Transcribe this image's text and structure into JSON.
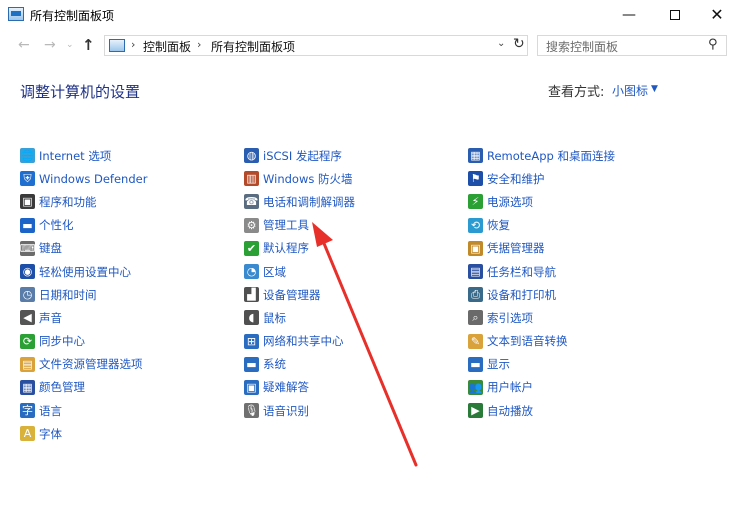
{
  "window": {
    "title": "所有控制面板项",
    "minimize_glyph": "—",
    "close_glyph": "✕"
  },
  "nav": {
    "back_glyph": "←",
    "forward_glyph": "→",
    "history_glyph": "⌄",
    "up_glyph": "↑",
    "breadcrumb": [
      "控制面板",
      "所有控制面板项"
    ],
    "breadcrumb_sep": "›",
    "dropdown_glyph": "⌄",
    "refresh_glyph": "↻"
  },
  "search": {
    "placeholder": "搜索控制面板",
    "icon_glyph": "⚲"
  },
  "header": {
    "title": "调整计算机的设置",
    "view_by_label": "查看方式:",
    "view_by_value": "小图标",
    "view_by_caret": "▼"
  },
  "columns": [
    [
      {
        "label": "Internet 选项",
        "icon": "globe-icon",
        "glyph": "🌐",
        "color": "#3aa0d8"
      },
      {
        "label": "Windows Defender",
        "icon": "shield-icon",
        "glyph": "⛨",
        "color": "#1e6fd0"
      },
      {
        "label": "程序和功能",
        "icon": "programs-icon",
        "glyph": "▣",
        "color": "#3a3a3a"
      },
      {
        "label": "个性化",
        "icon": "monitor-icon",
        "glyph": "▬",
        "color": "#1d64c8"
      },
      {
        "label": "键盘",
        "icon": "keyboard-icon",
        "glyph": "⌨",
        "color": "#6b6b6b"
      },
      {
        "label": "轻松使用设置中心",
        "icon": "ease-of-access-icon",
        "glyph": "◉",
        "color": "#1e4fa8"
      },
      {
        "label": "日期和时间",
        "icon": "clock-icon",
        "glyph": "◷",
        "color": "#5a7ca8"
      },
      {
        "label": "声音",
        "icon": "speaker-icon",
        "glyph": "◀",
        "color": "#555555"
      },
      {
        "label": "同步中心",
        "icon": "sync-icon",
        "glyph": "⟳",
        "color": "#2aa035"
      },
      {
        "label": "文件资源管理器选项",
        "icon": "folder-options-icon",
        "glyph": "▤",
        "color": "#d9a23a"
      },
      {
        "label": "颜色管理",
        "icon": "color-management-icon",
        "glyph": "▦",
        "color": "#2a4fa0"
      },
      {
        "label": "语言",
        "icon": "language-icon",
        "glyph": "字",
        "color": "#2a6dc0"
      },
      {
        "label": "字体",
        "icon": "font-icon",
        "glyph": "A",
        "color": "#d8b23a"
      }
    ],
    [
      {
        "label": "iSCSI 发起程序",
        "icon": "iscsi-icon",
        "glyph": "◍",
        "color": "#2a5db0"
      },
      {
        "label": "Windows 防火墙",
        "icon": "firewall-icon",
        "glyph": "▥",
        "color": "#b34a2a"
      },
      {
        "label": "电话和调制解调器",
        "icon": "phone-modem-icon",
        "glyph": "☎",
        "color": "#5a6d80"
      },
      {
        "label": "管理工具",
        "icon": "admin-tools-icon",
        "glyph": "⚙",
        "color": "#8a8a8a"
      },
      {
        "label": "默认程序",
        "icon": "default-programs-icon",
        "glyph": "✔",
        "color": "#2aa035"
      },
      {
        "label": "区域",
        "icon": "region-icon",
        "glyph": "◔",
        "color": "#3a8ad0"
      },
      {
        "label": "设备管理器",
        "icon": "device-manager-icon",
        "glyph": "▟",
        "color": "#505050"
      },
      {
        "label": "鼠标",
        "icon": "mouse-icon",
        "glyph": "◖",
        "color": "#505050"
      },
      {
        "label": "网络和共享中心",
        "icon": "network-icon",
        "glyph": "⊞",
        "color": "#2a6dc0"
      },
      {
        "label": "系统",
        "icon": "system-icon",
        "glyph": "▬",
        "color": "#2a6dc0"
      },
      {
        "label": "疑难解答",
        "icon": "troubleshoot-icon",
        "glyph": "▣",
        "color": "#2a6dc0"
      },
      {
        "label": "语音识别",
        "icon": "microphone-icon",
        "glyph": "🎙",
        "color": "#707070"
      }
    ],
    [
      {
        "label": "RemoteApp 和桌面连接",
        "icon": "remoteapp-icon",
        "glyph": "▦",
        "color": "#2a5db0"
      },
      {
        "label": "安全和维护",
        "icon": "flag-icon",
        "glyph": "⚑",
        "color": "#1e4fa8"
      },
      {
        "label": "电源选项",
        "icon": "power-icon",
        "glyph": "⚡",
        "color": "#2aa035"
      },
      {
        "label": "恢复",
        "icon": "recovery-icon",
        "glyph": "⟲",
        "color": "#2a9ad0"
      },
      {
        "label": "凭据管理器",
        "icon": "credential-icon",
        "glyph": "▣",
        "color": "#c08a2a"
      },
      {
        "label": "任务栏和导航",
        "icon": "taskbar-icon",
        "glyph": "▤",
        "color": "#2a4fa0"
      },
      {
        "label": "设备和打印机",
        "icon": "printer-icon",
        "glyph": "⎙",
        "color": "#3a6a8a"
      },
      {
        "label": "索引选项",
        "icon": "indexing-icon",
        "glyph": "⌕",
        "color": "#6a6a6a"
      },
      {
        "label": "文本到语音转换",
        "icon": "text-to-speech-icon",
        "glyph": "✎",
        "color": "#d9a23a"
      },
      {
        "label": "显示",
        "icon": "display-icon",
        "glyph": "▬",
        "color": "#2a6dc0"
      },
      {
        "label": "用户帐户",
        "icon": "user-accounts-icon",
        "glyph": "👥",
        "color": "#3a8a3a"
      },
      {
        "label": "自动播放",
        "icon": "autoplay-icon",
        "glyph": "▶",
        "color": "#2a7a3a"
      }
    ]
  ],
  "colors": {
    "link": "#1f58c3",
    "title": "#1e3287",
    "annotation_arrow": "#e8302a"
  }
}
